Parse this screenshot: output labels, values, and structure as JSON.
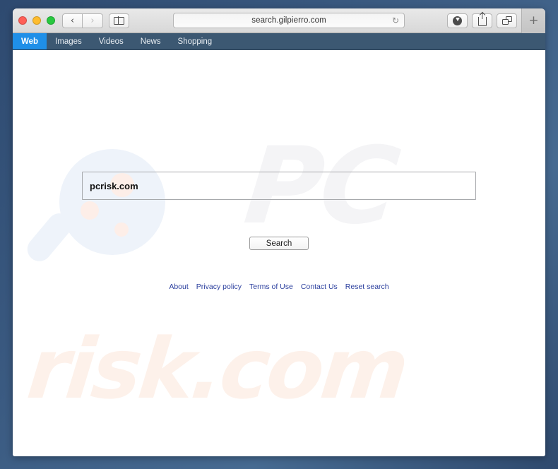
{
  "window": {
    "traffic_lights": [
      {
        "name": "close",
        "color": "#ff5f57"
      },
      {
        "name": "minimize",
        "color": "#febc2e"
      },
      {
        "name": "maximize",
        "color": "#28c840"
      }
    ],
    "nav_back_icon": "‹",
    "nav_forward_icon": "›",
    "sidebar_icon": "sidebar-icon",
    "downloads_icon": "download-icon",
    "share_icon": "share-icon",
    "tabs_icon": "tab-overview-icon",
    "new_tab_label": "+"
  },
  "address_bar": {
    "url": "search.gilpierro.com",
    "reload_icon": "↻"
  },
  "site_nav": {
    "items": [
      {
        "label": "Web",
        "active": true
      },
      {
        "label": "Images",
        "active": false
      },
      {
        "label": "Videos",
        "active": false
      },
      {
        "label": "News",
        "active": false
      },
      {
        "label": "Shopping",
        "active": false
      }
    ],
    "active_color": "#1f8fe8",
    "bar_color": "#3c5872"
  },
  "search_page": {
    "query_value": "pcrisk.com",
    "query_placeholder": "",
    "search_button_label": "Search",
    "footer_links": [
      "About",
      "Privacy policy",
      "Terms of Use",
      "Contact Us",
      "Reset search"
    ],
    "link_color": "#2b3f9e"
  },
  "watermark": {
    "lens_icon": "magnifier-icon",
    "text_primary": "PC",
    "text_secondary": "risk.com",
    "primary_color": "#f4f4f6",
    "secondary_color": "#fdf1ea",
    "lens_color": "#eef3fa",
    "dot_color": "#fdeee8"
  }
}
